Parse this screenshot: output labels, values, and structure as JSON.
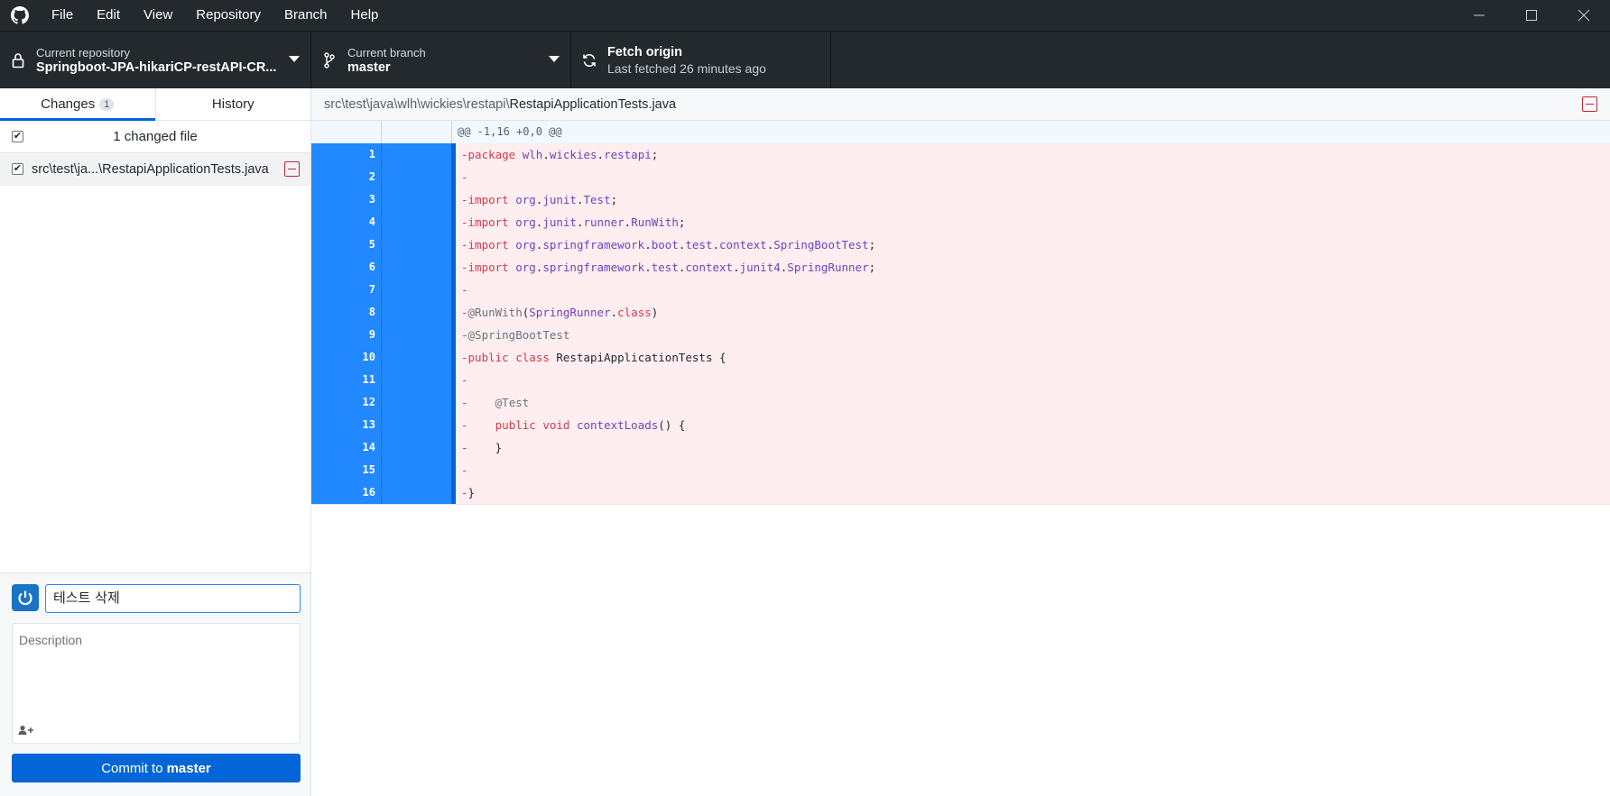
{
  "menu": [
    "File",
    "Edit",
    "View",
    "Repository",
    "Branch",
    "Help"
  ],
  "toolbar": {
    "repo_label": "Current repository",
    "repo_value": "Springboot-JPA-hikariCP-restAPI-CR...",
    "branch_label": "Current branch",
    "branch_value": "master",
    "fetch_label": "Fetch origin",
    "fetch_sub": "Last fetched 26 minutes ago"
  },
  "sidebar": {
    "tabs": [
      {
        "label": "Changes",
        "badge": "1"
      },
      {
        "label": "History"
      }
    ],
    "changed_count": "1 changed file",
    "file_path": "src\\test\\ja...\\RestapiApplicationTests.java",
    "summary_value": "테스트 삭제",
    "description_placeholder": "Description",
    "commit_label": "Commit to",
    "commit_branch": "master"
  },
  "diff": {
    "path_dir": "src\\test\\java\\wlh\\wickies\\restapi\\",
    "path_file": "RestapiApplicationTests.java",
    "hunk": "@@ -1,16 +0,0 @@",
    "lines": [
      {
        "n": "1",
        "html": "-<k>package</k> <t>wlh</t>.<t>wickies</t>.<t>restapi</t>;"
      },
      {
        "n": "2",
        "html": "-"
      },
      {
        "n": "3",
        "html": "-<k>import</k> <t>org</t>.<t>junit</t>.<t>Test</t>;"
      },
      {
        "n": "4",
        "html": "-<k>import</k> <t>org</t>.<t>junit</t>.<t>runner</t>.<t>RunWith</t>;"
      },
      {
        "n": "5",
        "html": "-<k>import</k> <t>org</t>.<t>springframework</t>.<t>boot</t>.<t>test</t>.<t>context</t>.<t>SpringBootTest</t>;"
      },
      {
        "n": "6",
        "html": "-<k>import</k> <t>org</t>.<t>springframework</t>.<t>test</t>.<t>context</t>.<t>junit4</t>.<t>SpringRunner</t>;"
      },
      {
        "n": "7",
        "html": "-"
      },
      {
        "n": "8",
        "html": "-<a>@RunWith</a>(<t>SpringRunner</t>.<k>class</k>)"
      },
      {
        "n": "9",
        "html": "-<a>@SpringBootTest</a>"
      },
      {
        "n": "10",
        "html": "-<k>public</k> <k>class</k> RestapiApplicationTests {"
      },
      {
        "n": "11",
        "html": "-"
      },
      {
        "n": "12",
        "html": "-    <a>@Test</a>"
      },
      {
        "n": "13",
        "html": "-    <k>public</k> <k>void</k> <t>contextLoads</t>() {"
      },
      {
        "n": "14",
        "html": "-    }"
      },
      {
        "n": "15",
        "html": "-"
      },
      {
        "n": "16",
        "html": "-}"
      }
    ]
  },
  "colors": {
    "keyword": "#d73a49",
    "type": "#6f42c1",
    "annotation": "#6a737d",
    "accent": "#0366d6"
  }
}
